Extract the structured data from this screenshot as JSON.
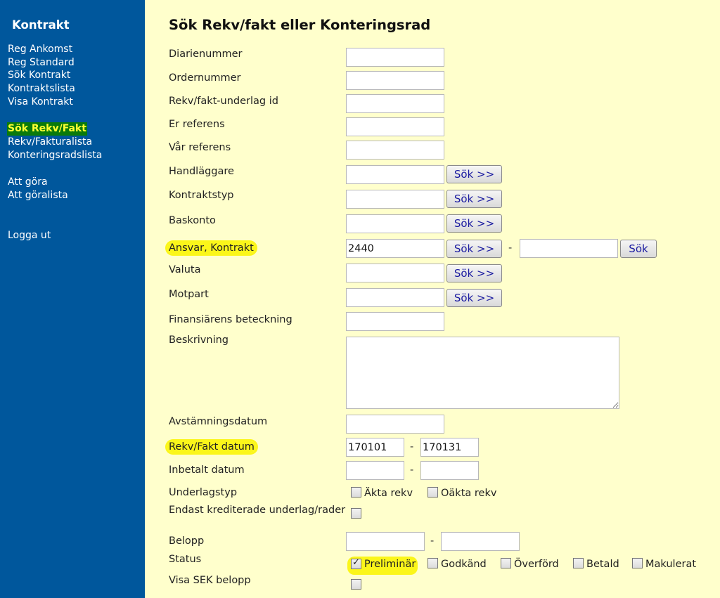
{
  "sidebar": {
    "title": "Kontrakt",
    "links": [
      "Reg Ankomst",
      "Reg Standard",
      "Sök Kontrakt",
      "Kontraktslista",
      "Visa Kontrakt",
      "Sök Rekv/Fakt",
      "Rekv/Fakturalista",
      "Konteringsradslista",
      "Att göra",
      "Att göralista",
      "Logga ut"
    ],
    "active": "Sök Rekv/Fakt"
  },
  "page": {
    "title": "Sök Rekv/fakt eller Konteringsrad"
  },
  "form": {
    "diarienummer": {
      "label": "Diarienummer",
      "value": ""
    },
    "ordernummer": {
      "label": "Ordernummer",
      "value": ""
    },
    "underlag_id": {
      "label": "Rekv/fakt-underlag id",
      "value": ""
    },
    "er_referens": {
      "label": "Er referens",
      "value": ""
    },
    "var_referens": {
      "label": "Vår referens",
      "value": ""
    },
    "handlaggare": {
      "label": "Handläggare",
      "value": "",
      "button": "Sök >>"
    },
    "kontraktstyp": {
      "label": "Kontraktstyp",
      "value": "",
      "button": "Sök >>"
    },
    "baskonto": {
      "label": "Baskonto",
      "value": "",
      "button": "Sök >>"
    },
    "ansvar": {
      "label": "Ansvar, Kontrakt",
      "value": "2440",
      "button": "Sök >>",
      "separator": "-",
      "value2": "",
      "button2": "Sök"
    },
    "valuta": {
      "label": "Valuta",
      "value": "",
      "button": "Sök >>"
    },
    "motpart": {
      "label": "Motpart",
      "value": "",
      "button": "Sök >>"
    },
    "finansiar": {
      "label": "Finansiärens beteckning",
      "value": ""
    },
    "beskrivning": {
      "label": "Beskrivning",
      "value": ""
    },
    "avstamningsdatum": {
      "label": "Avstämningsdatum",
      "value": ""
    },
    "rekv_datum": {
      "label": "Rekv/Fakt datum",
      "from": "170101",
      "separator": "-",
      "to": "170131"
    },
    "inbetalt_datum": {
      "label": "Inbetalt datum",
      "from": "",
      "separator": "-",
      "to": ""
    },
    "underlagstyp": {
      "label": "Underlagstyp",
      "options": [
        {
          "label": "Äkta rekv",
          "checked": false
        },
        {
          "label": "Oäkta rekv",
          "checked": false
        }
      ]
    },
    "endast_krediterade": {
      "label": "Endast krediterade underlag/rader",
      "checked": false
    },
    "belopp": {
      "label": "Belopp",
      "from": "",
      "separator": "-",
      "to": ""
    },
    "status": {
      "label": "Status",
      "options": [
        {
          "label": "Preliminär",
          "checked": true
        },
        {
          "label": "Godkänd",
          "checked": false
        },
        {
          "label": "Överförd",
          "checked": false
        },
        {
          "label": "Betald",
          "checked": false
        },
        {
          "label": "Makulerat",
          "checked": false
        }
      ]
    },
    "visa_sek": {
      "label": "Visa SEK belopp",
      "checked": false
    }
  },
  "colors": {
    "sidebar_bg": "#00579c",
    "page_bg": "#ffffcc",
    "highlight": "#fbf61a",
    "active_link_bg": "#0a7a0a",
    "active_link_text": "#ffff33"
  }
}
